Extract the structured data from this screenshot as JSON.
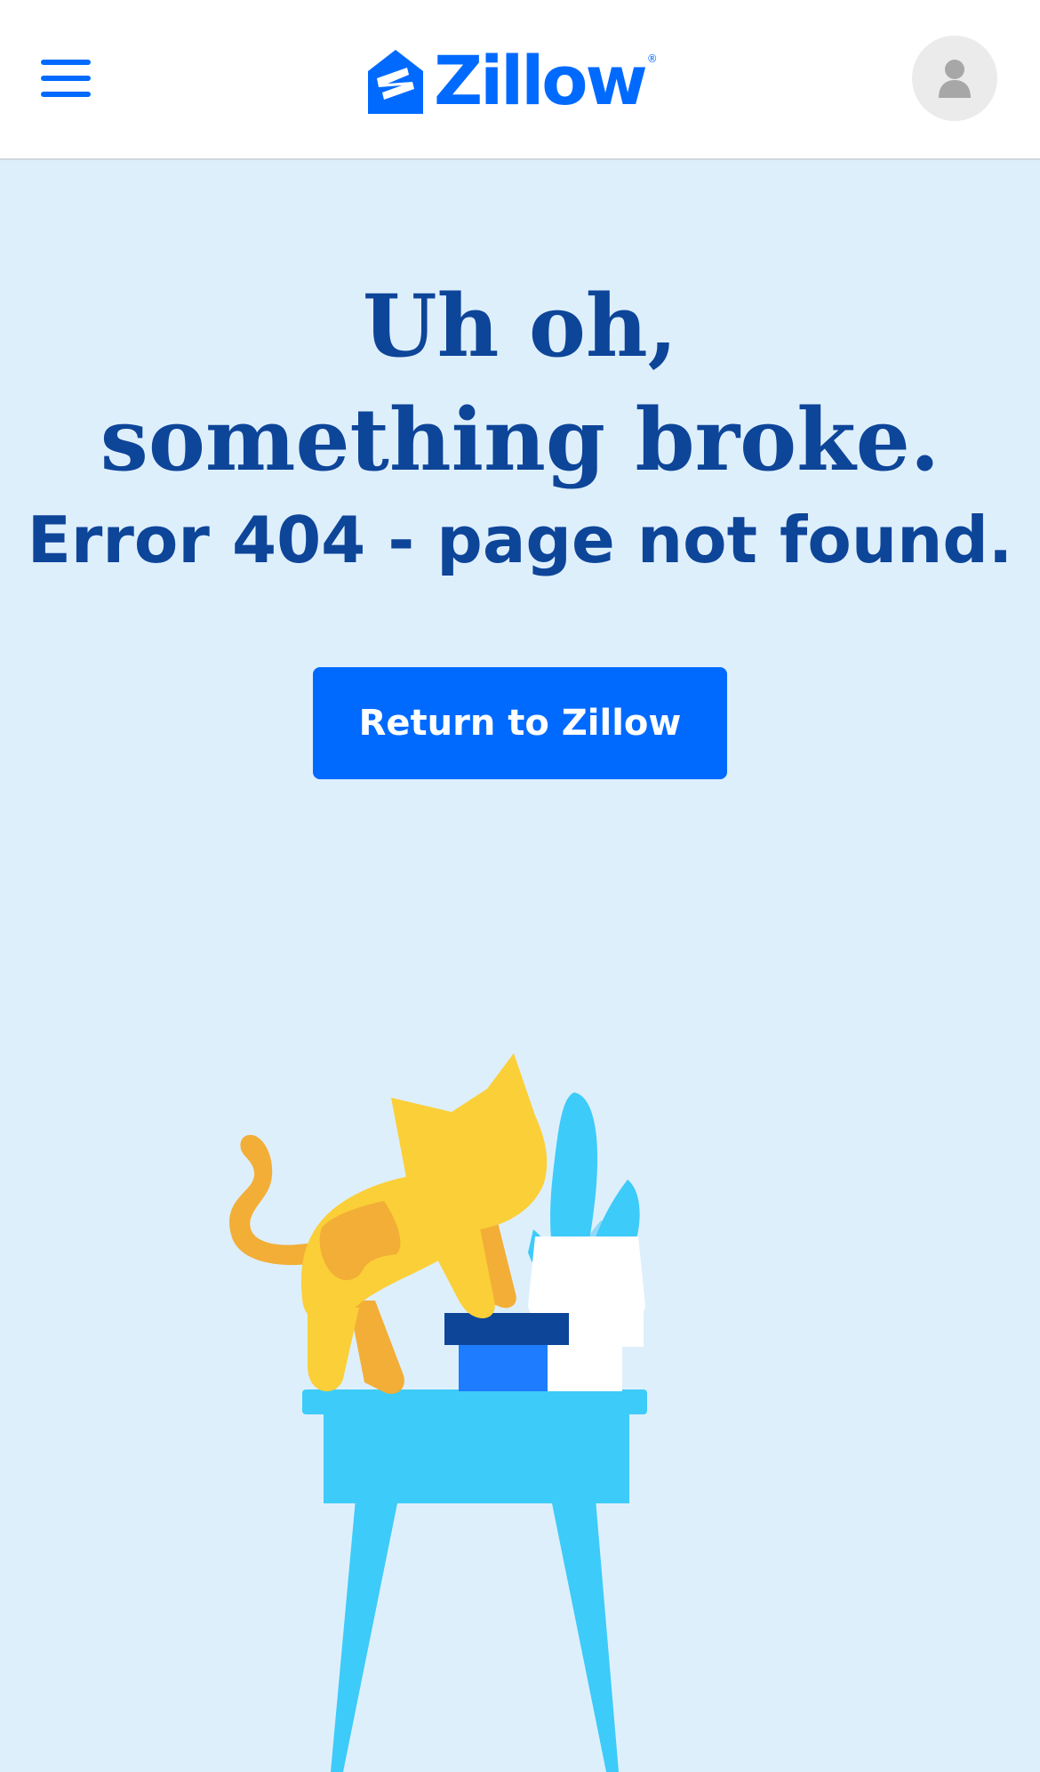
{
  "header": {
    "menu_icon": "hamburger-menu-icon",
    "logo_text": "Zillow",
    "logo_registered": "®",
    "avatar_icon": "user-icon"
  },
  "main": {
    "heading_line1": "Uh oh,",
    "heading_line2": "something broke.",
    "error_text": "Error 404 - page not found.",
    "return_button_label": "Return to Zillow"
  },
  "colors": {
    "brand_blue": "#006aff",
    "heading_navy": "#0d4599",
    "page_background": "#deeffc"
  }
}
